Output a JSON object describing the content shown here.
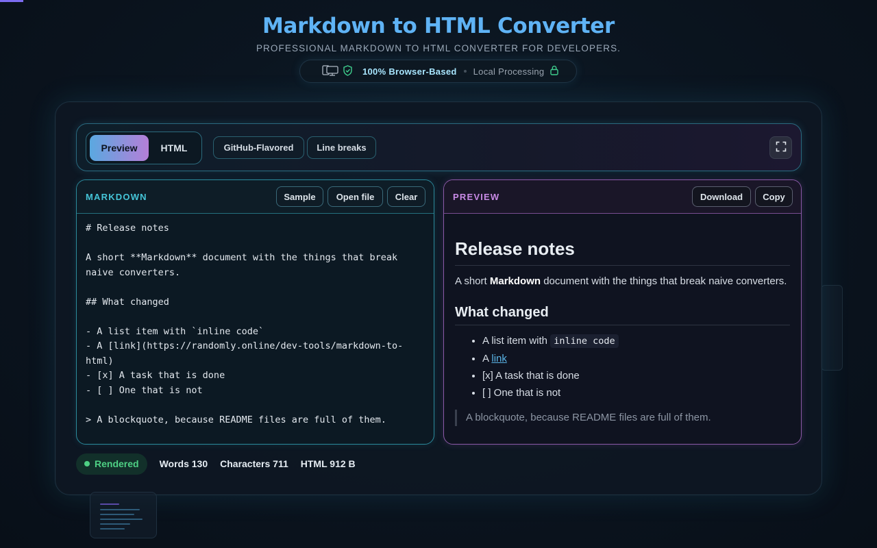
{
  "header": {
    "title": "Markdown to HTML Converter",
    "subtitle": "PROFESSIONAL MARKDOWN TO HTML CONVERTER FOR DEVELOPERS.",
    "badge_primary": "100% Browser-Based",
    "badge_secondary": "Local Processing"
  },
  "toolbar": {
    "tab_preview": "Preview",
    "tab_html": "HTML",
    "option_gfm": "GitHub-Flavored",
    "option_line_breaks": "Line breaks"
  },
  "editor_panel": {
    "title": "MARKDOWN",
    "sample_label": "Sample",
    "open_file_label": "Open file",
    "clear_label": "Clear",
    "lines": [
      "# Release notes",
      "",
      "A short **Markdown** document with the things that break",
      "naive converters.",
      "",
      "## What changed",
      "",
      "- A list item with `inline code`",
      "- A [link](https://randomly.online/dev-tools/markdown-to-",
      "html)",
      "- [x] A task that is done",
      "- [ ] One that is not",
      "",
      "> A blockquote, because README files are full of them."
    ]
  },
  "preview_panel": {
    "title": "PREVIEW",
    "download_label": "Download",
    "copy_label": "Copy",
    "h1": "Release notes",
    "para_before": "A short ",
    "para_bold": "Markdown",
    "para_after": " document with the things that break naive converters.",
    "h2": "What changed",
    "li1_text": "A list item with ",
    "li1_code": "inline code",
    "li2_text": "A ",
    "li2_link": "link",
    "li3": "[x] A task that is done",
    "li4": "[ ] One that is not",
    "quote": "A blockquote, because README files are full of them."
  },
  "status": {
    "state": "Rendered",
    "words": "Words 130",
    "characters": "Characters 711",
    "html_size": "HTML 912 B"
  },
  "colors": {
    "accent_cyan": "#45c5d8",
    "accent_purple": "#c88ae6",
    "title_blue": "#5fb3f5",
    "status_green": "#4ed084"
  }
}
